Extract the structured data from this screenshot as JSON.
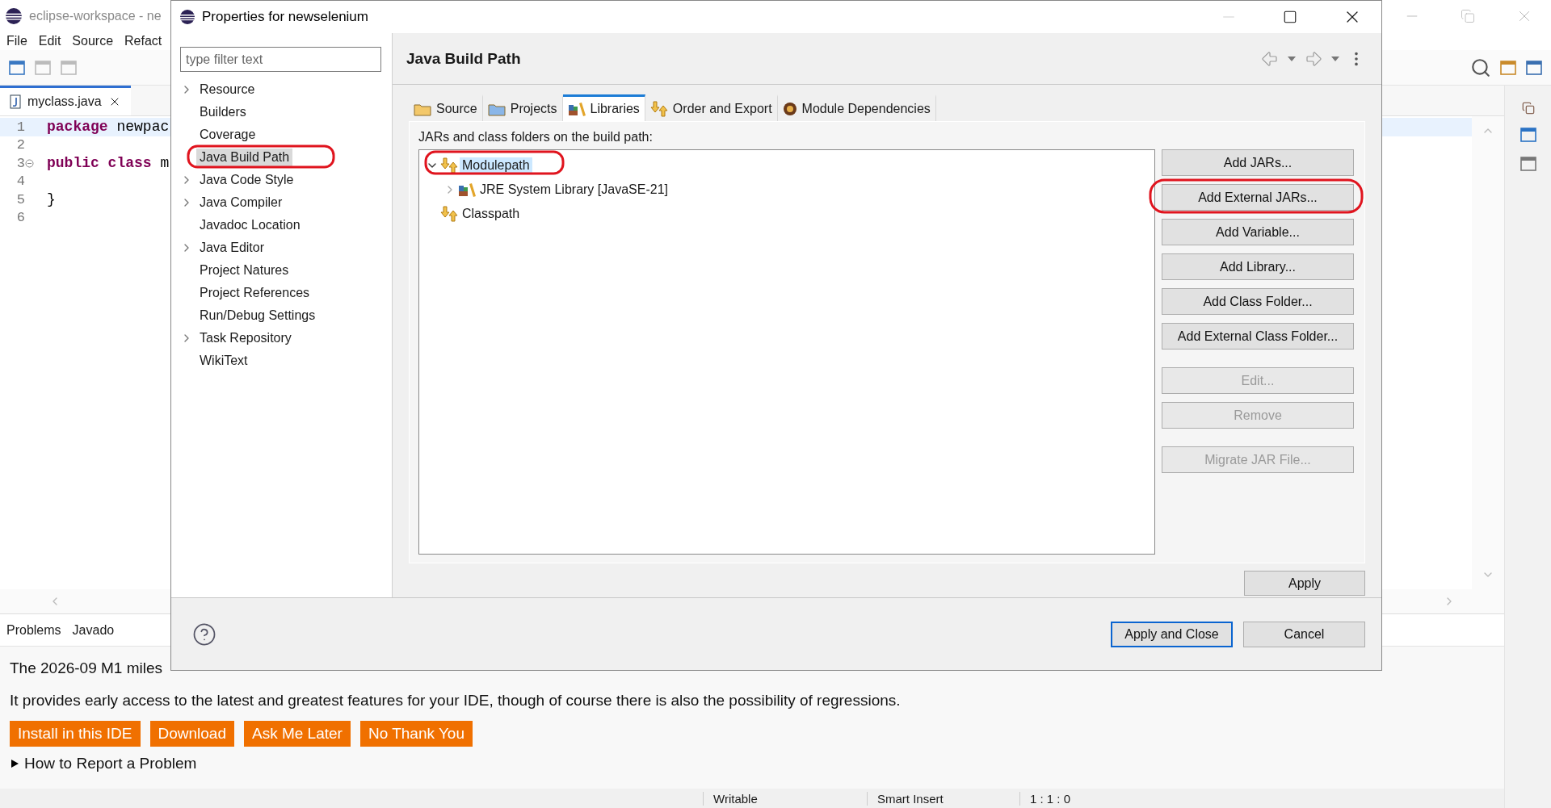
{
  "ide": {
    "title": "eclipse-workspace - ne",
    "menu": [
      "File",
      "Edit",
      "Source",
      "Refact"
    ],
    "editor_tab": {
      "label": "myclass.java",
      "selected": true
    },
    "code_lines": [
      {
        "number": "1",
        "current": true,
        "parts": [
          {
            "kind": "keyword",
            "text": "package"
          },
          {
            "kind": "plain",
            "text": " newpac"
          }
        ]
      },
      {
        "number": "2",
        "current": false
      },
      {
        "number": "3",
        "current": false,
        "foldable": true,
        "parts": [
          {
            "kind": "keyword",
            "text": "public class"
          },
          {
            "kind": "plain",
            "text": " m"
          }
        ]
      },
      {
        "number": "4",
        "current": false
      },
      {
        "number": "5",
        "current": false,
        "parts": [
          {
            "kind": "plain",
            "text": "}"
          }
        ]
      },
      {
        "number": "6",
        "current": false
      }
    ],
    "bottom_tabs": [
      {
        "label": "Problems",
        "selected": false
      },
      {
        "label": "Javado",
        "selected": false
      }
    ],
    "messages": [
      "The 2026-09 M1 miles",
      "It provides early access to the latest and greatest features for your IDE, though of course there is also the possibility of regressions."
    ],
    "actions": [
      "Install in this IDE",
      "Download",
      "Ask Me Later",
      "No Thank You"
    ],
    "disclosure": {
      "label": "How to Report a Problem",
      "expanded": false
    },
    "status": [
      "Writable",
      "Smart Insert",
      "1 : 1 : 0"
    ]
  },
  "dialog": {
    "title": "Properties for newselenium",
    "filter": {
      "placeholder": "type filter text"
    },
    "nav": [
      {
        "label": "Resource",
        "expandable": true,
        "selected": false
      },
      {
        "label": "Builders",
        "expandable": false,
        "selected": false
      },
      {
        "label": "Coverage",
        "expandable": false,
        "selected": false
      },
      {
        "label": "Java Build Path",
        "expandable": false,
        "selected": true
      },
      {
        "label": "Java Code Style",
        "expandable": true,
        "selected": false
      },
      {
        "label": "Java Compiler",
        "expandable": true,
        "selected": false
      },
      {
        "label": "Javadoc Location",
        "expandable": false,
        "selected": false
      },
      {
        "label": "Java Editor",
        "expandable": true,
        "selected": false
      },
      {
        "label": "Project Natures",
        "expandable": false,
        "selected": false
      },
      {
        "label": "Project References",
        "expandable": false,
        "selected": false
      },
      {
        "label": "Run/Debug Settings",
        "expandable": false,
        "selected": false
      },
      {
        "label": "Task Repository",
        "expandable": true,
        "selected": false
      },
      {
        "label": "WikiText",
        "expandable": false,
        "selected": false
      }
    ],
    "page_title": "Java Build Path",
    "tabs": [
      {
        "label": "Source",
        "selected": false
      },
      {
        "label": "Projects",
        "selected": false
      },
      {
        "label": "Libraries",
        "selected": true
      },
      {
        "label": "Order and Export",
        "selected": false
      },
      {
        "label": "Module Dependencies",
        "selected": false
      }
    ],
    "tree_label": "JARs and class folders on the build path:",
    "tree": [
      {
        "label": "Modulepath",
        "expandable": true,
        "expanded": true,
        "selected": true,
        "children": [
          {
            "label": "JRE System Library [JavaSE-21]",
            "expandable": true,
            "expanded": false,
            "selected": false
          }
        ]
      },
      {
        "label": "Classpath",
        "expandable": false,
        "selected": false
      }
    ],
    "button_groups": [
      [
        {
          "label": "Add JARs...",
          "disabled": false
        },
        {
          "label": "Add External JARs...",
          "disabled": false
        },
        {
          "label": "Add Variable...",
          "disabled": false
        },
        {
          "label": "Add Library...",
          "disabled": false
        },
        {
          "label": "Add Class Folder...",
          "disabled": false
        },
        {
          "label": "Add External Class Folder...",
          "disabled": false
        }
      ],
      [
        {
          "label": "Edit...",
          "disabled": true
        },
        {
          "label": "Remove",
          "disabled": true
        }
      ],
      [
        {
          "label": "Migrate JAR File...",
          "disabled": true
        }
      ]
    ],
    "apply": "Apply",
    "footer_buttons": [
      {
        "label": "Apply and Close",
        "default": true
      },
      {
        "label": "Cancel",
        "default": false
      }
    ]
  }
}
